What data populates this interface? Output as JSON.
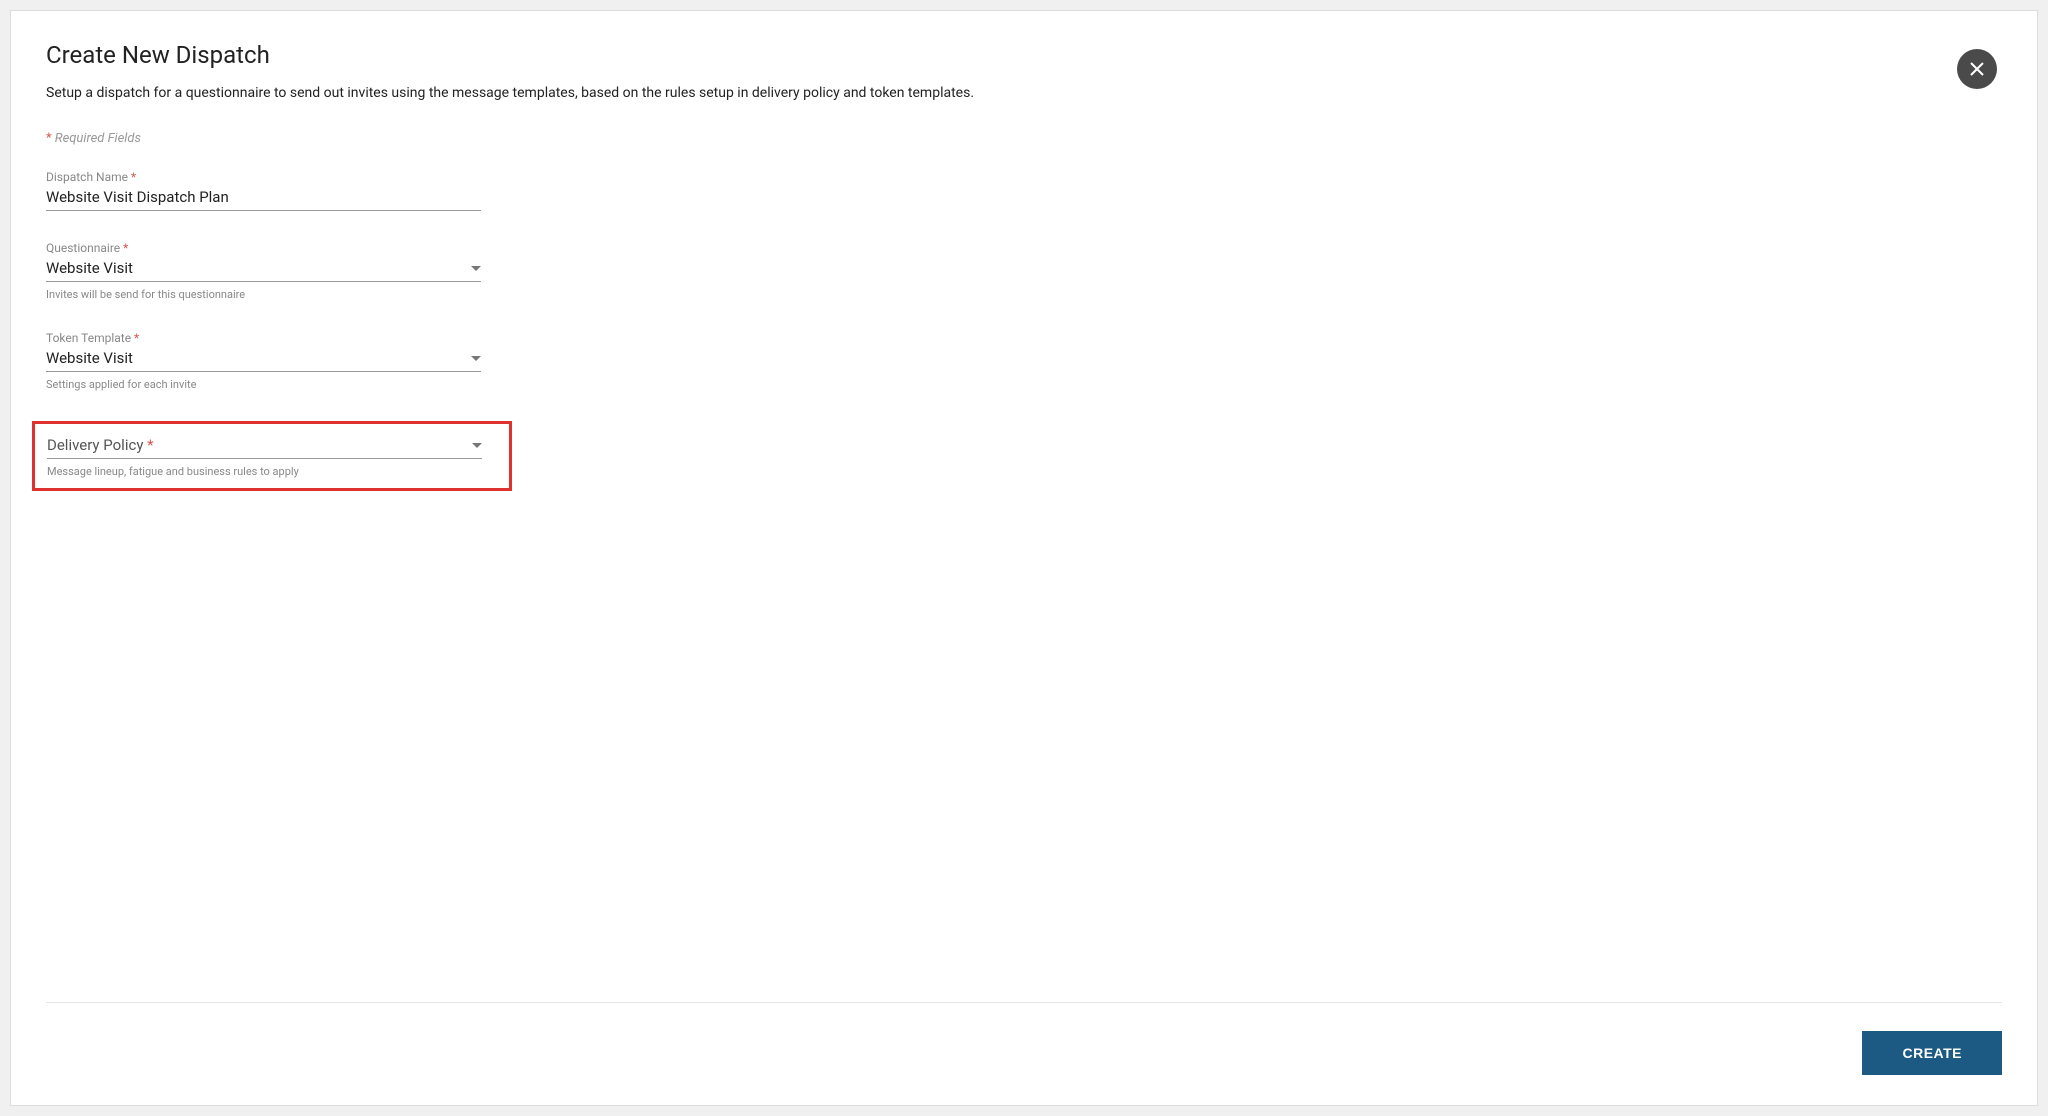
{
  "header": {
    "title": "Create New Dispatch",
    "subtitle": "Setup a dispatch for a questionnaire to send out invites using the message templates, based on the rules setup in delivery policy and token templates."
  },
  "required_note_prefix": "*",
  "required_note_text": " Required Fields",
  "fields": {
    "dispatch_name": {
      "label": "Dispatch Name ",
      "value": "Website Visit Dispatch Plan"
    },
    "questionnaire": {
      "label": "Questionnaire ",
      "value": "Website Visit",
      "hint": "Invites will be send for this questionnaire"
    },
    "token_template": {
      "label": "Token Template ",
      "value": "Website Visit",
      "hint": "Settings applied for each invite"
    },
    "delivery_policy": {
      "label": "Delivery Policy ",
      "value": "",
      "hint": "Message lineup, fatigue and business rules to apply"
    }
  },
  "asterisk": "*",
  "footer": {
    "create_label": "CREATE"
  }
}
